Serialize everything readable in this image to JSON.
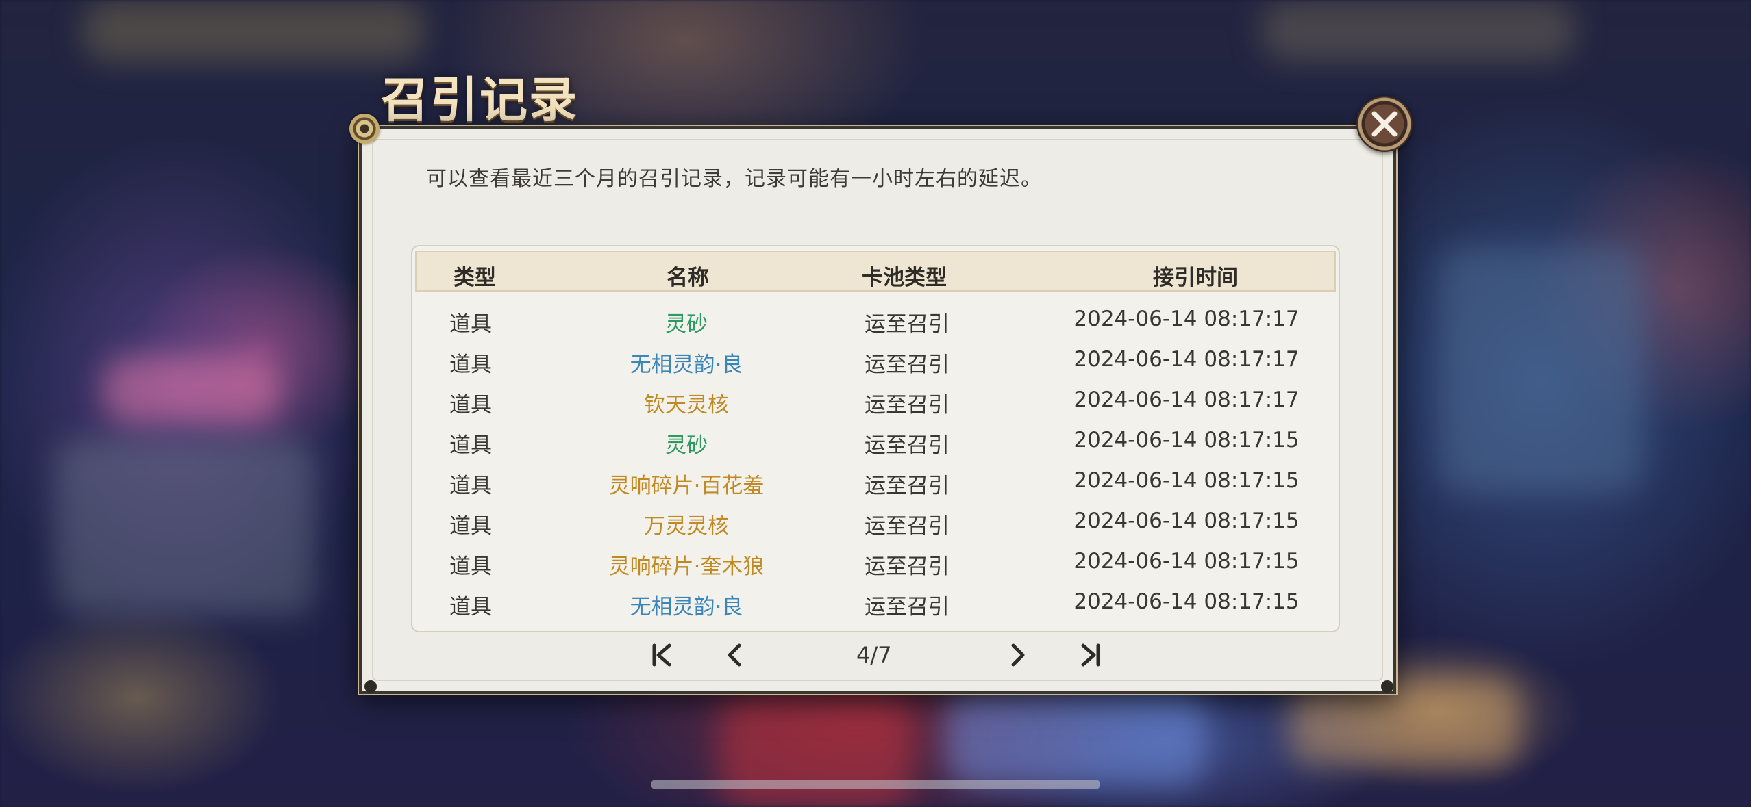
{
  "title": "召引记录",
  "hint": "可以查看最近三个月的召引记录，记录可能有一小时左右的延迟。",
  "colors": {
    "green": "#2e9a63",
    "blue": "#3a86b8",
    "gold": "#c08a22"
  },
  "table": {
    "headers": {
      "type": "类型",
      "name": "名称",
      "pool": "卡池类型",
      "time": "接引时间"
    },
    "rows": [
      {
        "type": "道具",
        "name": "灵砂",
        "name_color": "green",
        "pool": "运至召引",
        "time": "2024-06-14 08:17:17"
      },
      {
        "type": "道具",
        "name": "无相灵韵·良",
        "name_color": "blue",
        "pool": "运至召引",
        "time": "2024-06-14 08:17:17"
      },
      {
        "type": "道具",
        "name": "钦天灵核",
        "name_color": "gold",
        "pool": "运至召引",
        "time": "2024-06-14 08:17:17"
      },
      {
        "type": "道具",
        "name": "灵砂",
        "name_color": "green",
        "pool": "运至召引",
        "time": "2024-06-14 08:17:15"
      },
      {
        "type": "道具",
        "name": "灵响碎片·百花羞",
        "name_color": "gold",
        "pool": "运至召引",
        "time": "2024-06-14 08:17:15"
      },
      {
        "type": "道具",
        "name": "万灵灵核",
        "name_color": "gold",
        "pool": "运至召引",
        "time": "2024-06-14 08:17:15"
      },
      {
        "type": "道具",
        "name": "灵响碎片·奎木狼",
        "name_color": "gold",
        "pool": "运至召引",
        "time": "2024-06-14 08:17:15"
      },
      {
        "type": "道具",
        "name": "无相灵韵·良",
        "name_color": "blue",
        "pool": "运至召引",
        "time": "2024-06-14 08:17:15"
      }
    ]
  },
  "pagination": {
    "current": 4,
    "total": 7,
    "label": "4/7"
  },
  "icons": {
    "close": "close-icon",
    "first": "first-page-icon",
    "prev": "prev-page-icon",
    "next": "next-page-icon",
    "last": "last-page-icon"
  }
}
